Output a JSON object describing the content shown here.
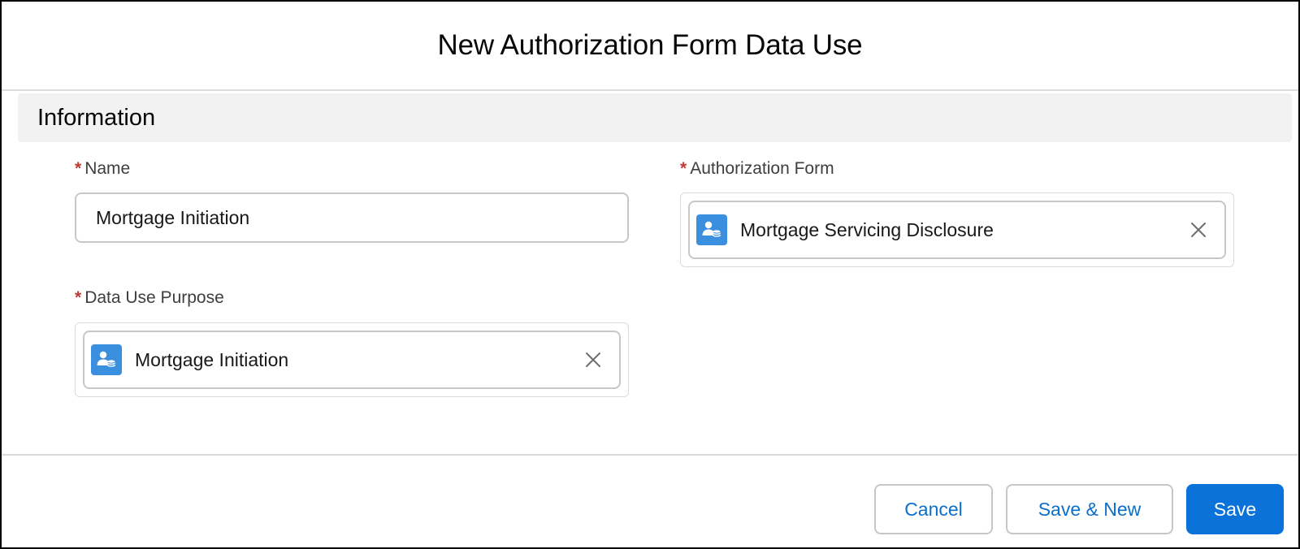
{
  "modal": {
    "title": "New Authorization Form Data Use"
  },
  "section": {
    "title": "Information"
  },
  "fields": {
    "name": {
      "required_marker": "*",
      "label": "Name",
      "value": "Mortgage Initiation"
    },
    "authorization_form": {
      "required_marker": "*",
      "label": "Authorization Form",
      "value": "Mortgage Servicing Disclosure",
      "icon": "record-icon",
      "clear_icon": "close-icon"
    },
    "data_use_purpose": {
      "required_marker": "*",
      "label": "Data Use Purpose",
      "value": "Mortgage Initiation",
      "icon": "record-icon",
      "clear_icon": "close-icon"
    }
  },
  "footer": {
    "cancel_label": "Cancel",
    "save_new_label": "Save & New",
    "save_label": "Save"
  },
  "colors": {
    "required": "#c23934",
    "brand": "#0b72d9",
    "link": "#0b6fcc",
    "section_bg": "#f3f2f2",
    "record_icon": "#3a8fde"
  }
}
